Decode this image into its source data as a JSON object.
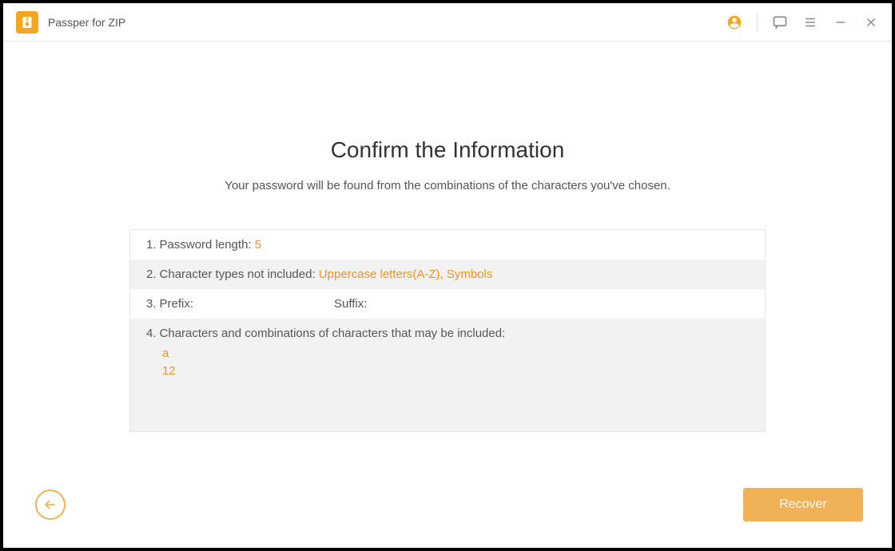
{
  "titlebar": {
    "app_name": "Passper for ZIP"
  },
  "main": {
    "title": "Confirm the Information",
    "subtitle": "Your password will be found from the combinations of the characters you've chosen.",
    "rows": {
      "r1_label": "Password length: ",
      "r1_value": "5",
      "r2_label": "Character types not included: ",
      "r2_value": "Uppercase letters(A-Z), Symbols",
      "r3_prefix": "Prefix:",
      "r3_suffix": "Suffix:",
      "r4_label": "Characters and combinations of characters that may be included:",
      "combo1": "a",
      "combo2": "12"
    },
    "nums": {
      "n1": "1.",
      "n2": "2.",
      "n3": "3.",
      "n4": "4."
    }
  },
  "buttons": {
    "recover": "Recover"
  }
}
